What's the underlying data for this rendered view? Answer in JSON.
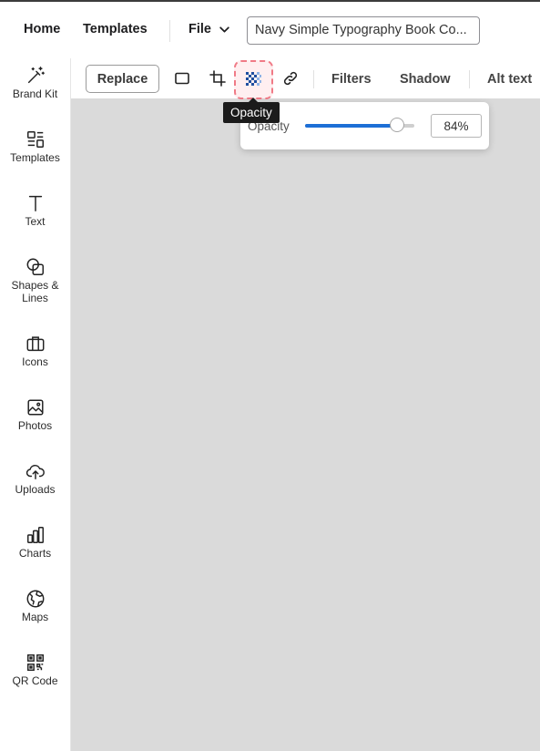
{
  "topbar": {
    "home": "Home",
    "templates": "Templates",
    "file": "File",
    "doc_title": "Navy Simple Typography Book Co..."
  },
  "sidebar": {
    "items": [
      {
        "label": "Brand Kit",
        "icon": "magic-wand-icon"
      },
      {
        "label": "Templates",
        "icon": "templates-icon"
      },
      {
        "label": "Text",
        "icon": "text-icon"
      },
      {
        "label": "Shapes &\nLines",
        "icon": "shapes-icon"
      },
      {
        "label": "Icons",
        "icon": "briefcase-icon"
      },
      {
        "label": "Photos",
        "icon": "photo-icon"
      },
      {
        "label": "Uploads",
        "icon": "upload-cloud-icon"
      },
      {
        "label": "Charts",
        "icon": "bar-chart-icon"
      },
      {
        "label": "Maps",
        "icon": "globe-icon"
      },
      {
        "label": "QR Code",
        "icon": "qr-code-icon"
      }
    ]
  },
  "toolbar": {
    "replace": "Replace",
    "filters": "Filters",
    "shadow": "Shadow",
    "alt_text": "Alt text"
  },
  "tooltip": {
    "text": "Opacity"
  },
  "opacity_popover": {
    "label": "Opacity",
    "value": 84,
    "value_text": "84%"
  },
  "colors": {
    "accent": "#1d6fd6",
    "canvas": "#dadada",
    "highlight": "#f07a86"
  }
}
